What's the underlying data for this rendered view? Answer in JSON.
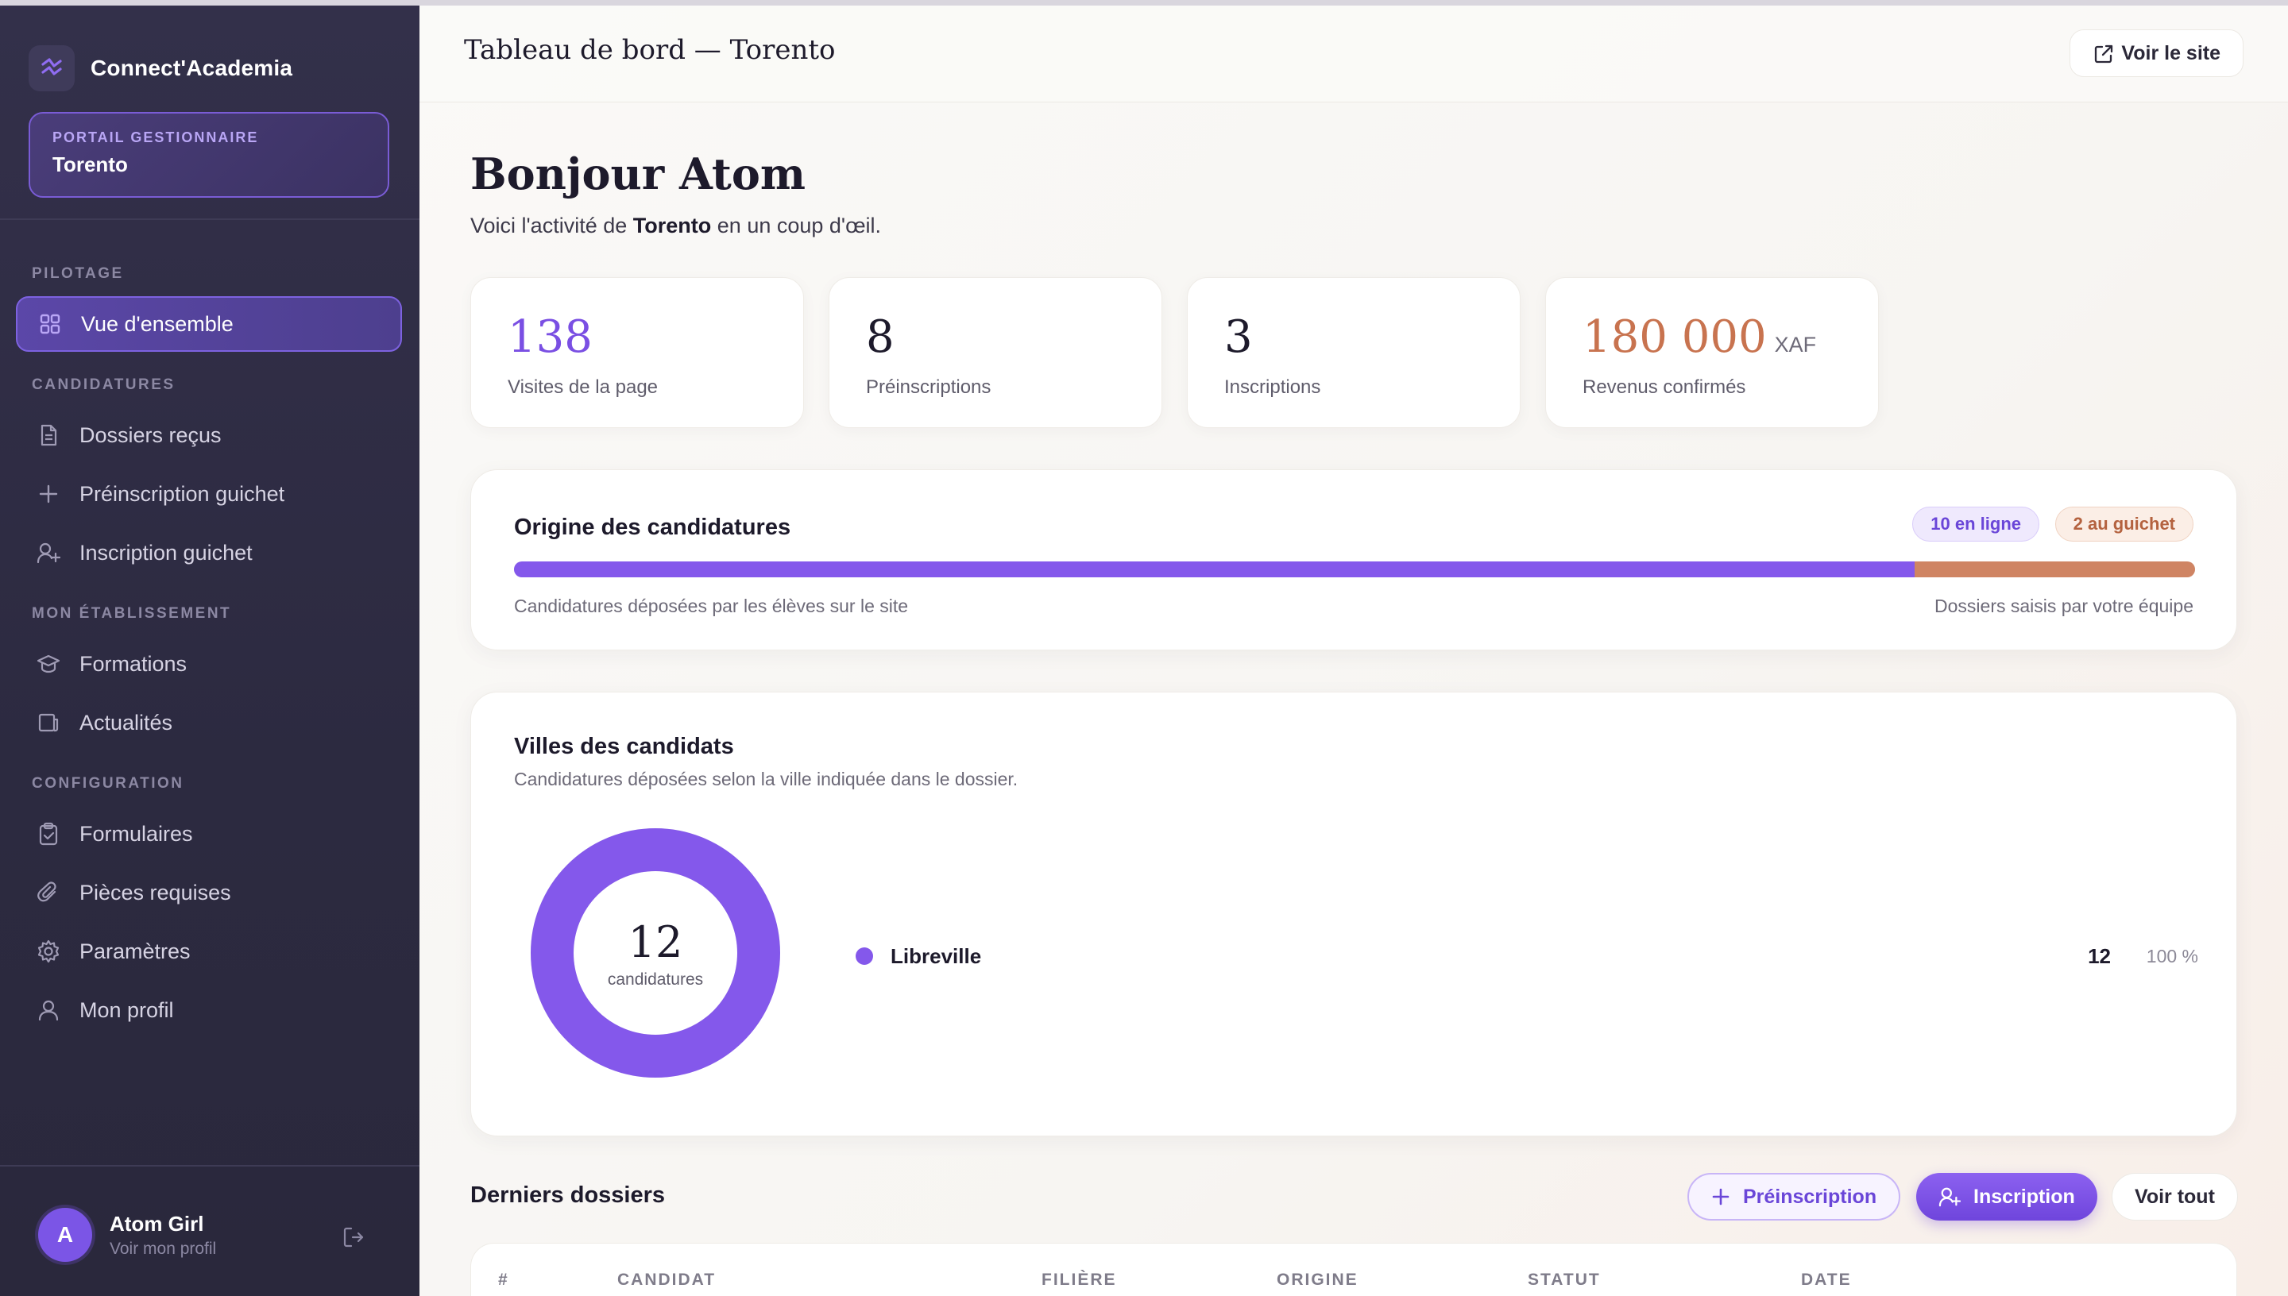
{
  "brand": {
    "name": "Connect'Academia"
  },
  "portal": {
    "kicker": "PORTAIL GESTIONNAIRE",
    "name": "Torento"
  },
  "nav": {
    "sections": [
      {
        "label": "PILOTAGE",
        "items": [
          {
            "label": "Vue d'ensemble",
            "icon": "grid-icon",
            "active": true
          }
        ]
      },
      {
        "label": "CANDIDATURES",
        "items": [
          {
            "label": "Dossiers reçus",
            "icon": "document-icon"
          },
          {
            "label": "Préinscription guichet",
            "icon": "plus-icon"
          },
          {
            "label": "Inscription guichet",
            "icon": "user-plus-icon"
          }
        ]
      },
      {
        "label": "MON ÉTABLISSEMENT",
        "items": [
          {
            "label": "Formations",
            "icon": "graduation-cap-icon"
          },
          {
            "label": "Actualités",
            "icon": "newspaper-icon"
          }
        ]
      },
      {
        "label": "CONFIGURATION",
        "items": [
          {
            "label": "Formulaires",
            "icon": "clipboard-check-icon"
          },
          {
            "label": "Pièces requises",
            "icon": "paperclip-icon"
          },
          {
            "label": "Paramètres",
            "icon": "gear-icon"
          },
          {
            "label": "Mon profil",
            "icon": "user-icon"
          }
        ]
      }
    ]
  },
  "user": {
    "initial": "A",
    "name": "Atom Girl",
    "sub": "Voir mon profil"
  },
  "header": {
    "title": "Tableau de bord — Torento",
    "view_site": "Voir le site"
  },
  "greeting": {
    "title": "Bonjour Atom",
    "sub_prefix": "Voici l'activité de",
    "sub_school": "Torento",
    "sub_suffix": "en un coup d'œil."
  },
  "kpis": [
    {
      "value": "138",
      "unit": "",
      "label": "Visites de la page",
      "color": "#7a4fe3"
    },
    {
      "value": "8",
      "unit": "",
      "label": "Préinscriptions",
      "color": "#1d1a2b"
    },
    {
      "value": "3",
      "unit": "",
      "label": "Inscriptions",
      "color": "#1d1a2b"
    },
    {
      "value": "180 000",
      "unit": "XAF",
      "label": "Revenus confirmés",
      "color": "#c8734f"
    }
  ],
  "origin": {
    "title": "Origine des candidatures",
    "online_pill": "10 en ligne",
    "desk_pill": "2 au guichet",
    "online_count": 10,
    "desk_count": 2,
    "online_caption": "Candidatures déposées par les élèves sur le site",
    "desk_caption": "Dossiers saisis par votre équipe",
    "colors": {
      "online": "#8458eb",
      "desk": "#cf8463"
    }
  },
  "cities": {
    "title": "Villes des candidats",
    "subtitle": "Candidatures déposées selon la ville indiquée dans le dossier.",
    "total": "12",
    "total_label": "candidatures",
    "items": [
      {
        "name": "Libreville",
        "count": "12",
        "pct": "100 %",
        "fraction": 1.0,
        "color": "#8458eb"
      }
    ]
  },
  "recent": {
    "title": "Derniers dossiers",
    "buttons": {
      "preinscription": "Préinscription",
      "inscription": "Inscription",
      "see_all": "Voir tout"
    },
    "columns": [
      "#",
      "CANDIDAT",
      "FILIÈRE",
      "ORIGINE",
      "STATUT",
      "DATE"
    ]
  }
}
